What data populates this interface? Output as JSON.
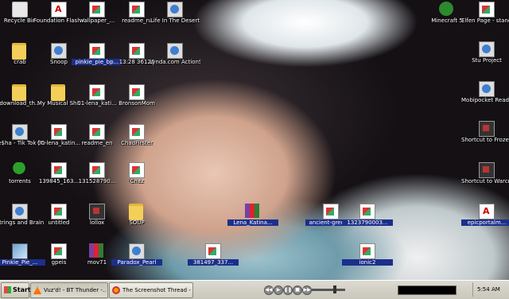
{
  "desktop": {
    "icons": [
      {
        "id": "recycle-bin",
        "label": "Recycle Bin",
        "type": "bin"
      },
      {
        "id": "foundation-flash",
        "label": "Foundation Flash CS5 Fo...",
        "type": "pdf"
      },
      {
        "id": "wallpaper",
        "label": "wallpaper_...",
        "type": "doc"
      },
      {
        "id": "readme-ru",
        "label": "readme_ru",
        "type": "doc"
      },
      {
        "id": "life-in-the-desert",
        "label": "Life In The Desert",
        "type": "exe"
      },
      {
        "id": "minecraft",
        "label": "Minecraft 5",
        "type": "app"
      },
      {
        "id": "elfen-page",
        "label": "Elfen Page - stand up su...",
        "type": "doc"
      },
      {
        "id": "crab",
        "label": "crab",
        "type": "folder"
      },
      {
        "id": "snoop",
        "label": "Snoop",
        "type": "exe"
      },
      {
        "id": "pinkie-pie-bp",
        "label": "pinkie_pie_bp...",
        "type": "doc",
        "selected": true
      },
      {
        "id": "file-13",
        "label": "13:28 36126",
        "type": "doc"
      },
      {
        "id": "lynda",
        "label": "Lynda.com ActionScrip...",
        "type": "exe"
      },
      {
        "id": "stu-project",
        "label": "Stu Project",
        "type": "exe"
      },
      {
        "id": "download-th",
        "label": "download_th...",
        "type": "folder"
      },
      {
        "id": "my-musical-shit",
        "label": "My Musical Shit",
        "type": "folder"
      },
      {
        "id": "lena-kati",
        "label": "01-lena_kati...",
        "type": "doc"
      },
      {
        "id": "bronsonmom",
        "label": "BronsonMom",
        "type": "doc"
      },
      {
        "id": "mobipocket",
        "label": "Mobipocket Reader",
        "type": "exe"
      },
      {
        "id": "kesha",
        "label": "Ke$ha - Tik Tok [Karaok...",
        "type": "exe"
      },
      {
        "id": "lena-katina-2",
        "label": "00-lena_katin...",
        "type": "doc"
      },
      {
        "id": "readme-en",
        "label": "readme_en",
        "type": "doc"
      },
      {
        "id": "chadfirster",
        "label": "ChadFirster",
        "type": "doc"
      },
      {
        "id": "frozen-throne",
        "label": "Shortcut to Frozen Throne",
        "type": "lnk"
      },
      {
        "id": "torrents",
        "label": "torrents",
        "type": "tree"
      },
      {
        "id": "file-139845",
        "label": "139845_163...",
        "type": "doc"
      },
      {
        "id": "file-131528",
        "label": "131528790...",
        "type": "doc"
      },
      {
        "id": "chaz",
        "label": "Chaz",
        "type": "doc"
      },
      {
        "id": "warcraft",
        "label": "Shortcut to Warcraft III",
        "type": "lnk"
      },
      {
        "id": "strings-and-brain",
        "label": "Strings and Brain",
        "type": "exe"
      },
      {
        "id": "untitled",
        "label": "untitled",
        "type": "doc"
      },
      {
        "id": "lollox",
        "label": "lollox",
        "type": "lnk"
      },
      {
        "id": "soup",
        "label": "SOUP",
        "type": "folder"
      },
      {
        "id": "lena-katina-rar",
        "label": "Lena_Katina...",
        "type": "rar",
        "selected": true
      },
      {
        "id": "ancient-greek",
        "label": "ancient-greek...",
        "type": "doc",
        "selected": true
      },
      {
        "id": "file-132379",
        "label": "1323790003...",
        "type": "doc",
        "selected": true
      },
      {
        "id": "epicportal",
        "label": "epicportalm...",
        "type": "pdf",
        "selected": true
      },
      {
        "id": "pinkie-pie-2",
        "label": "Pinkie_Pie_...",
        "type": "wall",
        "selected": true
      },
      {
        "id": "gpeis",
        "label": "gpeis",
        "type": "doc"
      },
      {
        "id": "mov71",
        "label": "mov71",
        "type": "rar"
      },
      {
        "id": "paradox-pearl",
        "label": "Paradox_Pearl",
        "type": "exe",
        "selected": true
      },
      {
        "id": "file-381497",
        "label": "381497_337...",
        "type": "doc",
        "selected": true
      },
      {
        "id": "ionic2",
        "label": "ionic2",
        "type": "doc",
        "selected": true
      }
    ]
  },
  "taskbar": {
    "start_label": "Start",
    "tasks": [
      {
        "label": "Vuz'd! - BT Thunder -...",
        "active": true
      },
      {
        "label": "The Screenshot Thread -...",
        "active": false
      }
    ],
    "player": {
      "buttons": [
        "◀◀",
        "▶",
        "❚❚",
        "■",
        "▶▶"
      ],
      "volume": 0.7
    },
    "progress": 0.0,
    "clock": "5:54 AM"
  }
}
